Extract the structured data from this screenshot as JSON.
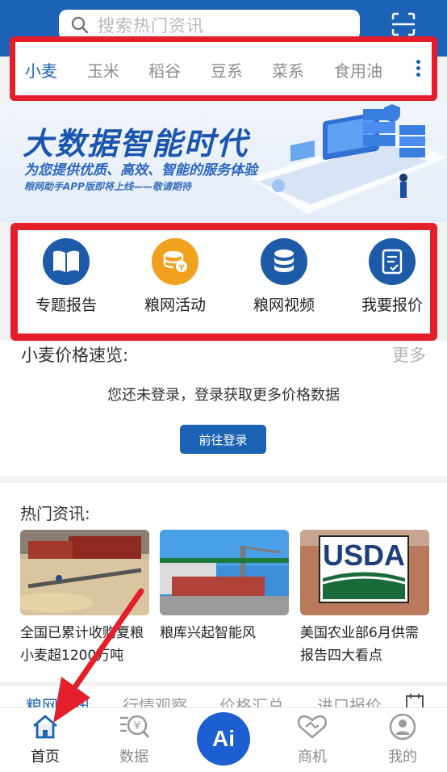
{
  "header": {
    "search_placeholder": "搜索热门资讯",
    "search_icon": "search-icon",
    "scan_icon": "scan-icon"
  },
  "categories": {
    "items": [
      "小麦",
      "玉米",
      "稻谷",
      "豆系",
      "菜系",
      "食用油"
    ],
    "active_index": 0,
    "more_icon": "kebab-menu-icon"
  },
  "banner": {
    "title": "大数据智能时代",
    "subtitle": "为您提供优质、高效、智能的服务体验",
    "note": "粮网助手APP版即将上线——敬请期待"
  },
  "shortcuts": [
    {
      "label": "专题报告",
      "icon": "book-icon",
      "color": "#1d5aa8"
    },
    {
      "label": "粮网活动",
      "icon": "coins-icon",
      "color": "#f0a11e"
    },
    {
      "label": "粮网视频",
      "icon": "database-icon",
      "color": "#1d5aa8"
    },
    {
      "label": "我要报价",
      "icon": "quote-form-icon",
      "color": "#1d5aa8"
    }
  ],
  "price": {
    "title": "小麦价格速览:",
    "more": "更多",
    "message": "您还未登录，登录获取更多价格数据",
    "login_button": "前往登录"
  },
  "news": {
    "title": "热门资讯:",
    "items": [
      {
        "caption": "全国已累计收购夏粮小麦超1200万吨"
      },
      {
        "caption": "粮库兴起智能风"
      },
      {
        "caption": "美国农业部6月供需报告四大看点",
        "image_text": "USDA"
      }
    ]
  },
  "subtabs": {
    "items": [
      "粮网资讯",
      "行情观察",
      "价格汇总",
      "进口报价"
    ],
    "active_index": 0
  },
  "bottom_nav": {
    "items": [
      {
        "label": "首页",
        "icon": "home-icon",
        "active": true
      },
      {
        "label": "数据",
        "icon": "data-icon",
        "active": false
      },
      {
        "label": "",
        "icon": "ai-icon",
        "text": "Ai",
        "active": false
      },
      {
        "label": "商机",
        "icon": "handshake-icon",
        "active": false
      },
      {
        "label": "我的",
        "icon": "user-icon",
        "active": false
      }
    ]
  },
  "colors": {
    "brand": "#1d63b5",
    "highlight_border": "#e41e2b",
    "accent_orange": "#f0a11e"
  }
}
